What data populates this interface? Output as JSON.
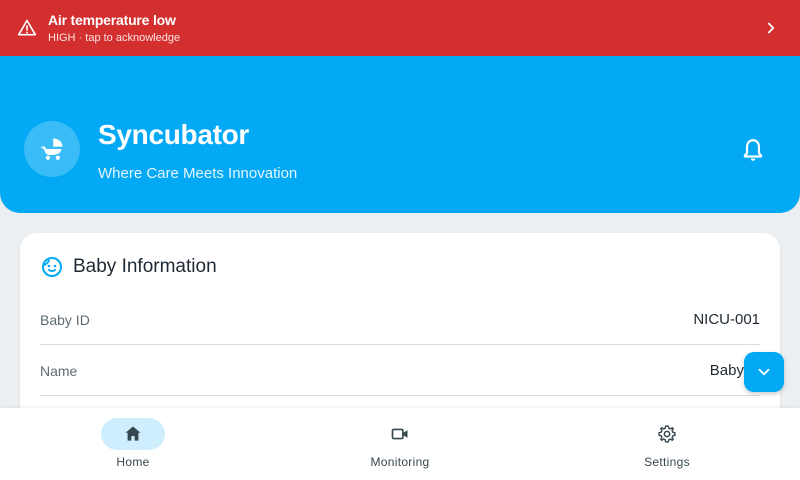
{
  "alert": {
    "title": "Air temperature low",
    "subtitle": "HIGH · tap to acknowledge",
    "icon": "warning-icon",
    "color": "#d32f2f"
  },
  "header": {
    "title": "Syncubator",
    "tagline": "Where Care Meets Innovation",
    "logo_icon": "baby-stroller-icon",
    "notification_icon": "bell-icon",
    "color": "#03a9f4"
  },
  "baby_info": {
    "title": "Baby Information",
    "icon": "baby-face-icon",
    "rows": [
      {
        "label": "Baby ID",
        "value": "NICU-001"
      },
      {
        "label": "Name",
        "value": "Baby"
      }
    ]
  },
  "fab": {
    "icon": "chevron-down-icon"
  },
  "nav": {
    "items": [
      {
        "label": "Home",
        "icon": "home-icon",
        "active": true
      },
      {
        "label": "Monitoring",
        "icon": "video-camera-icon",
        "active": false
      },
      {
        "label": "Settings",
        "icon": "gear-icon",
        "active": false
      }
    ]
  }
}
